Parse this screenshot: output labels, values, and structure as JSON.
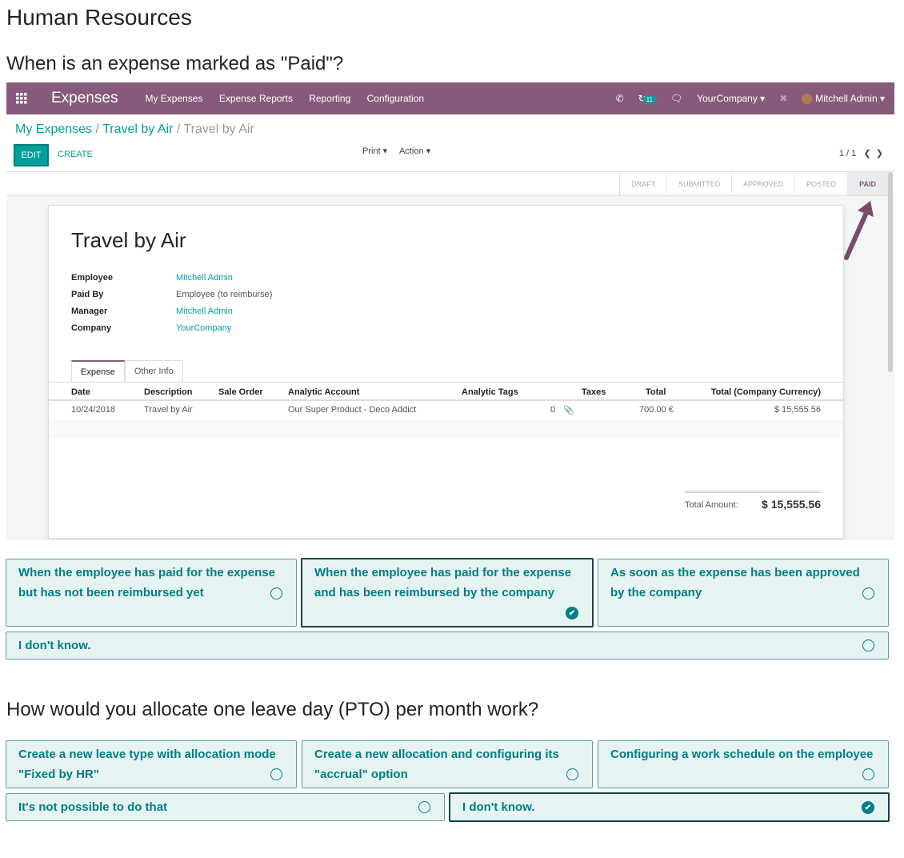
{
  "page_title": "Human Resources",
  "questions": [
    {
      "text": "When is an expense marked as \"Paid\"?",
      "answers": [
        "When the employee has paid for the expense but has not been reimbursed yet",
        "When the employee has paid for the expense and has been reimbursed by the company",
        "As soon as the expense has been approved by the company",
        "I don't know."
      ],
      "selected_index": 1
    },
    {
      "text": "How would you allocate one leave day (PTO) per month work?",
      "answers": [
        "Create a new leave type with allocation mode \"Fixed by HR\"",
        "Create a new allocation and configuring its \"accrual\" option",
        "Configuring a work schedule on the employee",
        "It's not possible to do that",
        "I don't know."
      ],
      "selected_index": 4
    }
  ],
  "screenshot": {
    "nav": {
      "app_name": "Expenses",
      "menu": [
        "My Expenses",
        "Expense Reports",
        "Reporting",
        "Configuration"
      ],
      "badge_count": "11",
      "company": "YourCompany",
      "user": "Mitchell Admin",
      "bar_color": "#875a7b"
    },
    "breadcrumb": {
      "first": "My Expenses",
      "second": "Travel by Air",
      "current": "Travel by Air"
    },
    "buttons": {
      "edit": "EDIT",
      "create": "CREATE",
      "print": "Print",
      "action": "Action"
    },
    "pager": "1 / 1",
    "stages": [
      "DRAFT",
      "SUBMITTED",
      "APPROVED",
      "POSTED",
      "PAID"
    ],
    "active_stage": "PAID",
    "record": {
      "title": "Travel by Air",
      "fields": [
        {
          "label": "Employee",
          "value": "Mitchell Admin"
        },
        {
          "label": "Paid By",
          "value": "Employee (to reimburse)"
        },
        {
          "label": "Manager",
          "value": "Mitchell Admin"
        },
        {
          "label": "Company",
          "value": "YourCompany"
        }
      ],
      "tabs": [
        "Expense",
        "Other Info"
      ],
      "columns": [
        "Date",
        "Description",
        "Sale Order",
        "Analytic Account",
        "Analytic Tags",
        "Taxes",
        "Total",
        "Total (Company Currency)"
      ],
      "row": {
        "date": "10/24/2018",
        "description": "Travel by Air",
        "analytic_account": "Our Super Product - Deco Addict",
        "attachments": "0",
        "total": "700.00 €",
        "total_company": "$ 15,555.56"
      },
      "total_label": "Total Amount:",
      "total_value": "$ 15,555.56"
    }
  },
  "colors": {
    "accent": "#017e84",
    "answer_bg": "#e6f3f3",
    "odoo_purple": "#875a7b",
    "odoo_teal": "#00a09d"
  }
}
